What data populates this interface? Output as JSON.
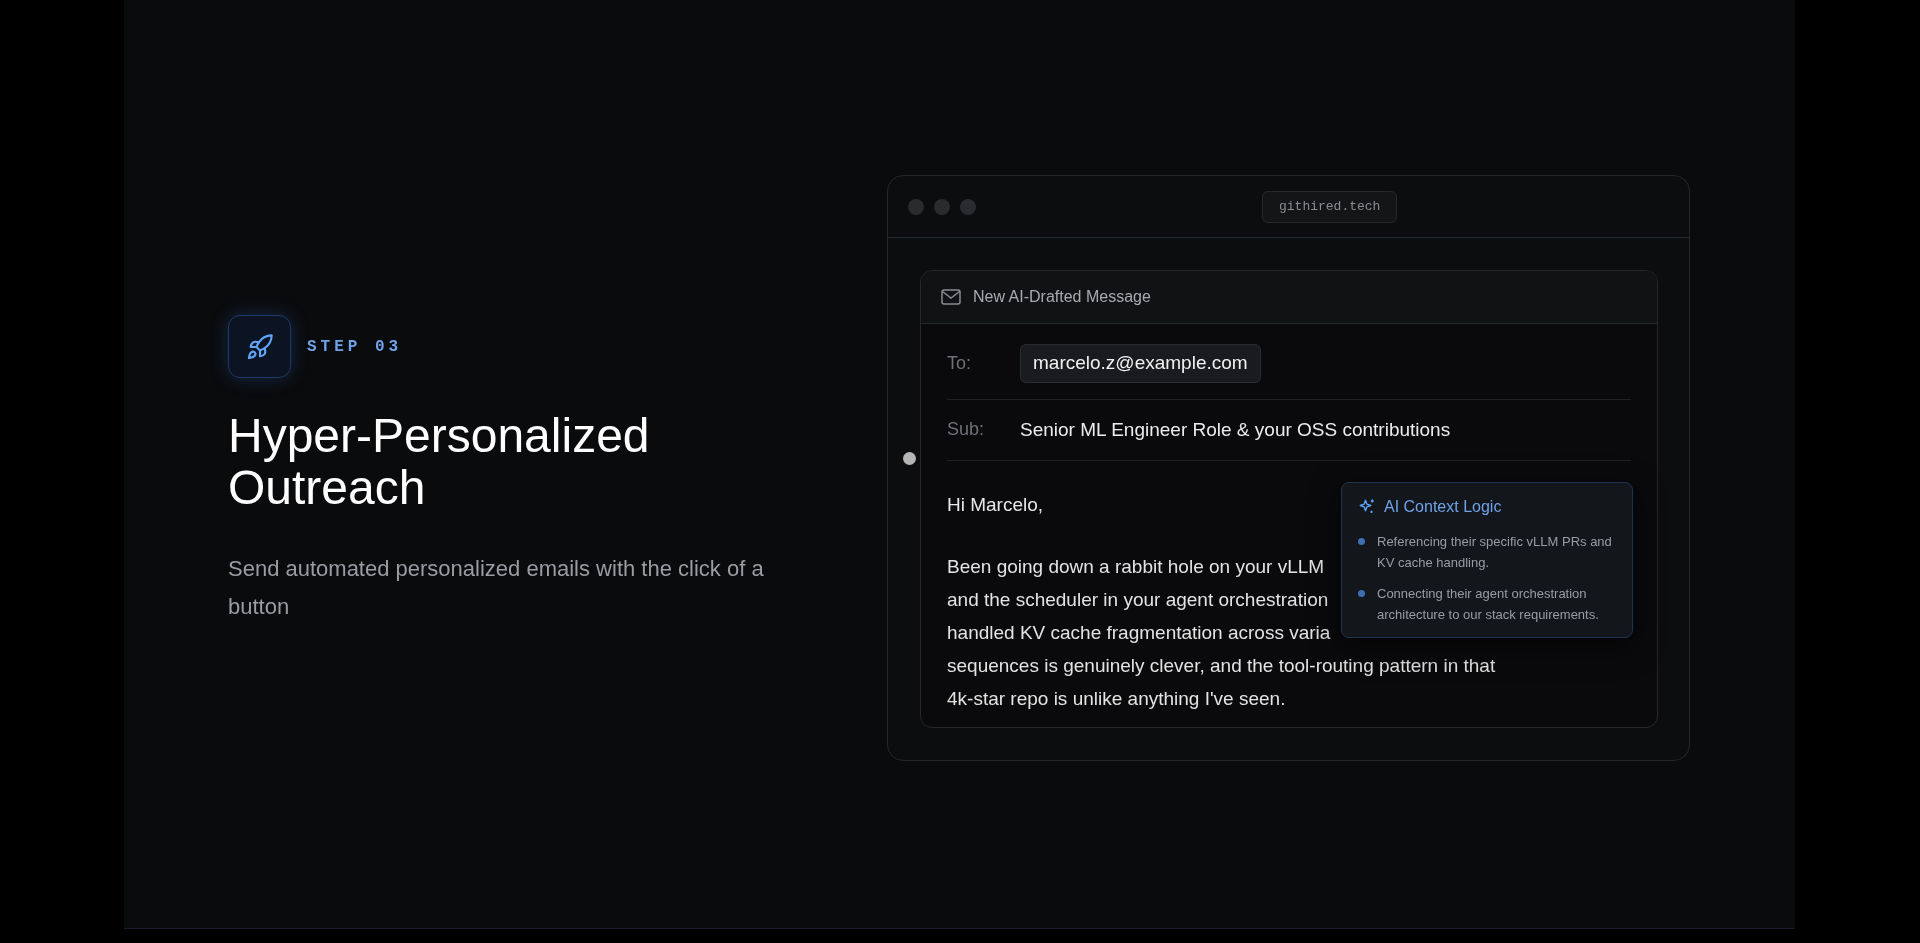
{
  "step": {
    "label": "STEP 03",
    "title": "Hyper-Personalized Outreach",
    "description": "Send automated personalized emails with the click of a button"
  },
  "browser": {
    "url": "githired.tech"
  },
  "email": {
    "header": "New AI-Drafted Message",
    "fields": [
      {
        "label": "To:",
        "value": "marcelo.z@example.com",
        "kind": "chip"
      },
      {
        "label": "Sub:",
        "value": "Senior ML Engineer Role & your OSS contributions",
        "kind": "plain"
      }
    ],
    "greeting": "Hi Marcelo,",
    "body_lines": [
      "Been going down a rabbit hole on your vLLM",
      "and the scheduler in your agent orchestration",
      "handled KV cache fragmentation across varia",
      "sequences is genuinely clever, and the tool-routing pattern in that",
      "4k-star repo is unlike anything I've seen."
    ]
  },
  "ai_context": {
    "title": "AI Context Logic",
    "points": [
      "Referencing their specific vLLM PRs and KV cache handling.",
      "Connecting their agent orchestration architecture to our stack requirements."
    ]
  }
}
